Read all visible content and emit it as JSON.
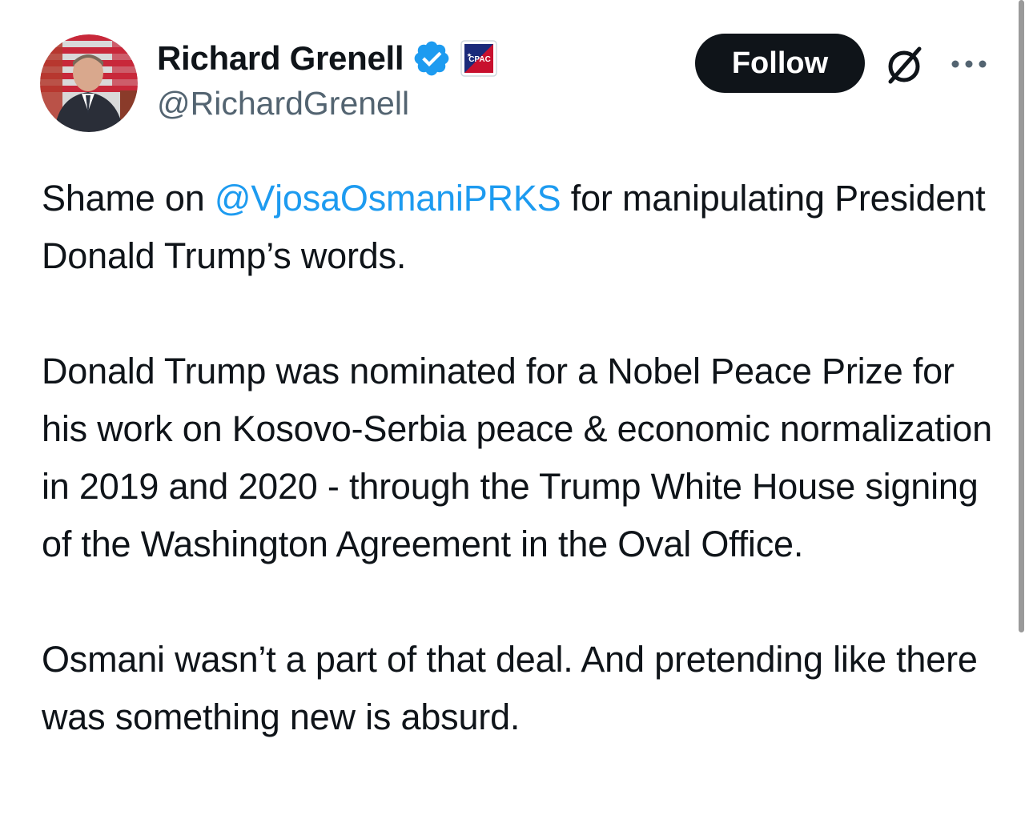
{
  "author": {
    "display_name": "Richard Grenell",
    "handle": "@RichardGrenell",
    "verified_icon": "verified-badge-icon",
    "affiliation_badge_text": "CPAC",
    "avatar_icon": "profile-photo"
  },
  "actions": {
    "follow_label": "Follow",
    "grok_icon": "grok-icon",
    "more_icon": "more-options-icon"
  },
  "tweet": {
    "p1_before": "Shame on ",
    "p1_mention": "@VjosaOsmaniPRKS",
    "p1_after": " for manipulating President Donald Trump’s words.",
    "p2": "Donald Trump was nominated for a Nobel Peace Prize for his work on Kosovo-Serbia peace & economic normalization in 2019 and 2020 - through the Trump White House signing of the Washington Agreement in the Oval Office.",
    "p3": "Osmani wasn’t a part of that deal. And pretending like there was something new is absurd."
  },
  "colors": {
    "text": "#0f1419",
    "secondary": "#536471",
    "link": "#1d9bf0",
    "verified": "#1d9bf0",
    "button_bg": "#0f1419",
    "button_text": "#ffffff"
  }
}
